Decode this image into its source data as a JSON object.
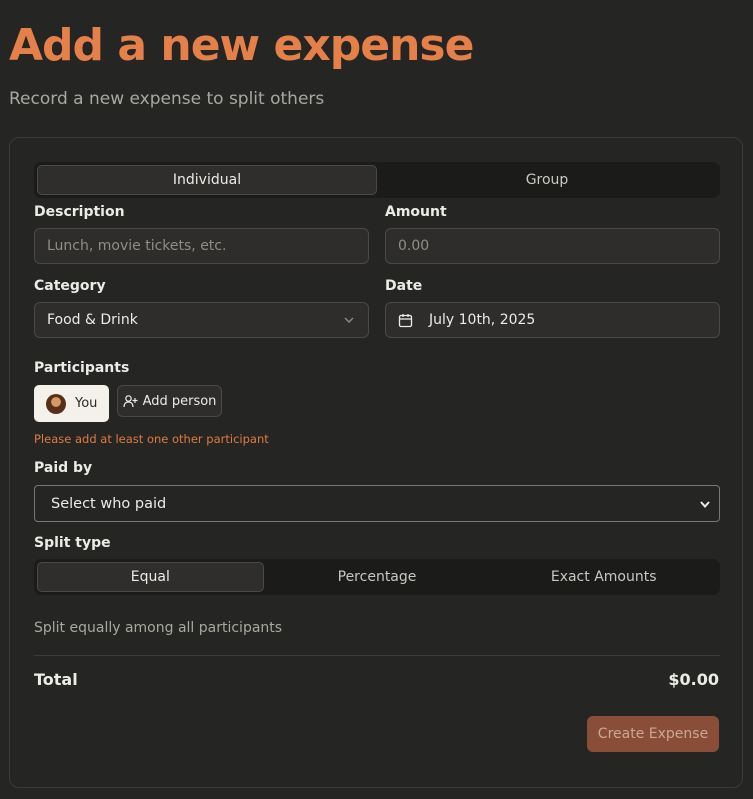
{
  "header": {
    "title": "Add a new expense",
    "subtitle": "Record a new expense to split others"
  },
  "expense_type_tabs": [
    {
      "label": "Individual",
      "active": true
    },
    {
      "label": "Group",
      "active": false
    }
  ],
  "description": {
    "label": "Description",
    "value": "",
    "placeholder": "Lunch, movie tickets, etc."
  },
  "amount": {
    "label": "Amount",
    "value": "",
    "placeholder": "0.00"
  },
  "category": {
    "label": "Category",
    "value": "Food & Drink"
  },
  "date": {
    "label": "Date",
    "value": "July 10th, 2025"
  },
  "participants": {
    "label": "Participants",
    "items": [
      {
        "name": "You"
      }
    ],
    "add_label": "Add person",
    "error": "Please add at least one other participant"
  },
  "paid_by": {
    "label": "Paid by",
    "value": "Select who paid"
  },
  "split_type": {
    "label": "Split type",
    "options": [
      {
        "label": "Equal",
        "active": true
      },
      {
        "label": "Percentage",
        "active": false
      },
      {
        "label": "Exact Amounts",
        "active": false
      }
    ],
    "hint": "Split equally among all participants"
  },
  "total": {
    "label": "Total",
    "value": "$0.00"
  },
  "submit_label": "Create Expense",
  "colors": {
    "accent": "#e5804b",
    "error": "#e07a3d",
    "button": "#8a4d37"
  }
}
